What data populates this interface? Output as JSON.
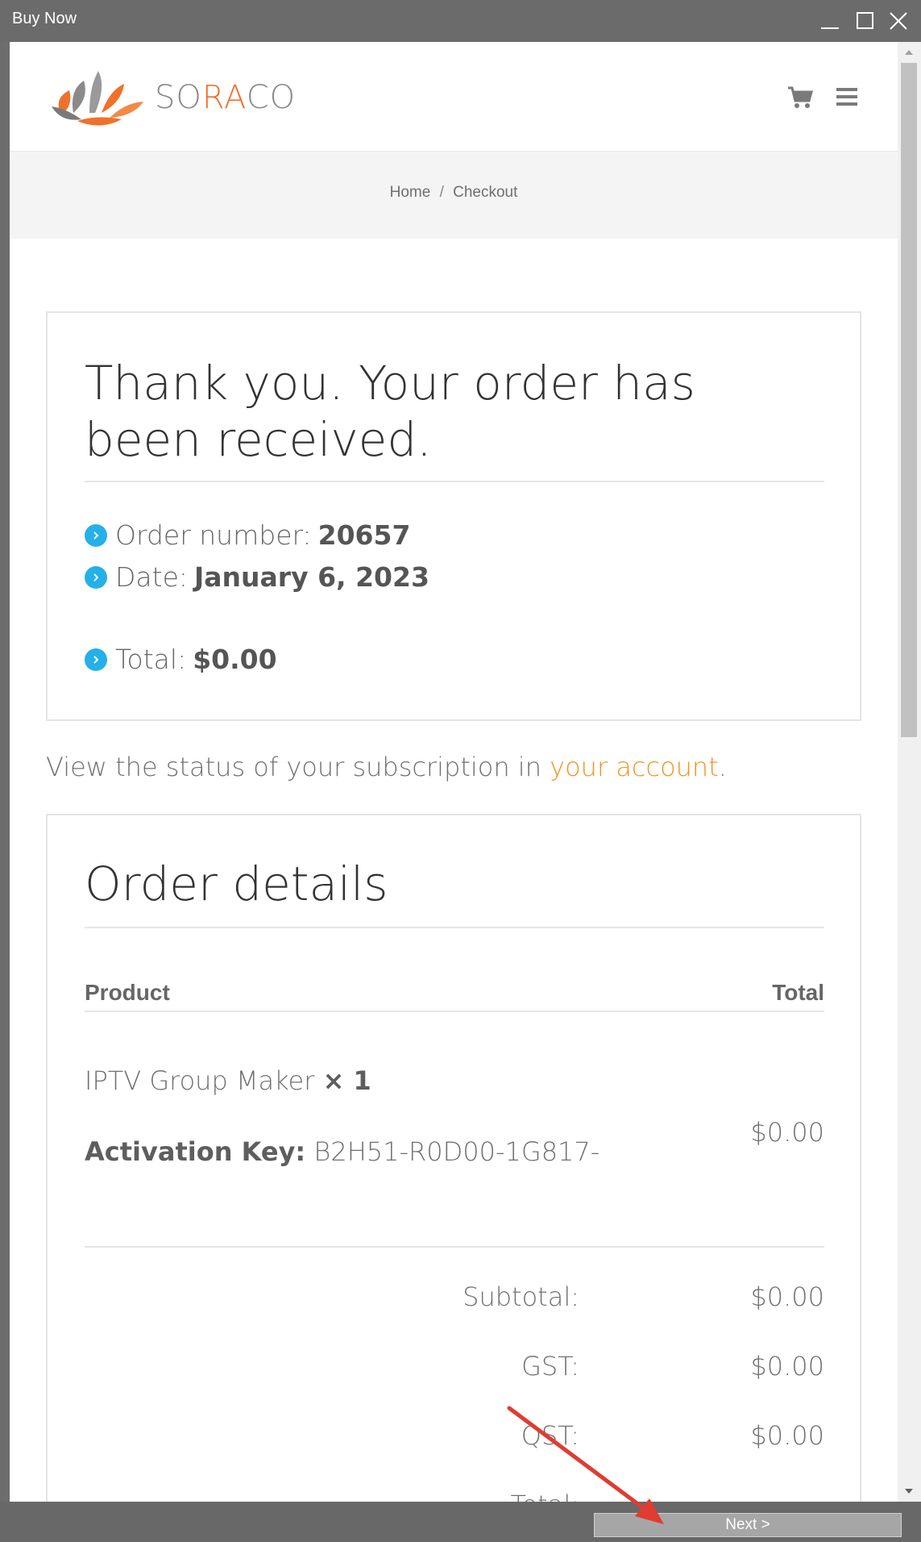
{
  "window": {
    "title": "Buy Now",
    "min_icon": "minimize-icon",
    "max_icon": "maximize-icon",
    "close_icon": "close-icon"
  },
  "header": {
    "logo_text_so": "SO",
    "logo_text_ra": "RA",
    "logo_text_co": "CO",
    "cart_icon": "cart-icon",
    "menu_icon": "hamburger-menu-icon"
  },
  "breadcrumb": {
    "home": "Home",
    "separator": "/",
    "current": "Checkout"
  },
  "confirmation": {
    "heading": "Thank you. Your order has been received.",
    "order_number_label": "Order number:",
    "order_number": "20657",
    "date_label": "Date:",
    "date": "January 6, 2023",
    "total_label": "Total:",
    "total": "$0.00"
  },
  "status": {
    "text": "View the status of your subscription in ",
    "link": "your account",
    "end": "."
  },
  "order_details": {
    "heading": "Order details",
    "col_product": "Product",
    "col_total": "Total",
    "item_name": "IPTV Group Maker",
    "item_qty": "× 1",
    "activation_label": "Activation Key:",
    "activation_key": "B2H51-R0D00-1G817-",
    "item_total": "$0.00",
    "subtotal_label": "Subtotal:",
    "subtotal": "$0.00",
    "gst_label": "GST:",
    "gst": "$0.00",
    "qst_label": "QST:",
    "qst": "$0.00",
    "total_label": "Total:"
  },
  "footer": {
    "next_label": "Next >"
  },
  "colors": {
    "accent_link": "#f29320",
    "bullet": "#24b0e8",
    "logo_orange": "#f0712b",
    "arrow": "#e03c31"
  }
}
